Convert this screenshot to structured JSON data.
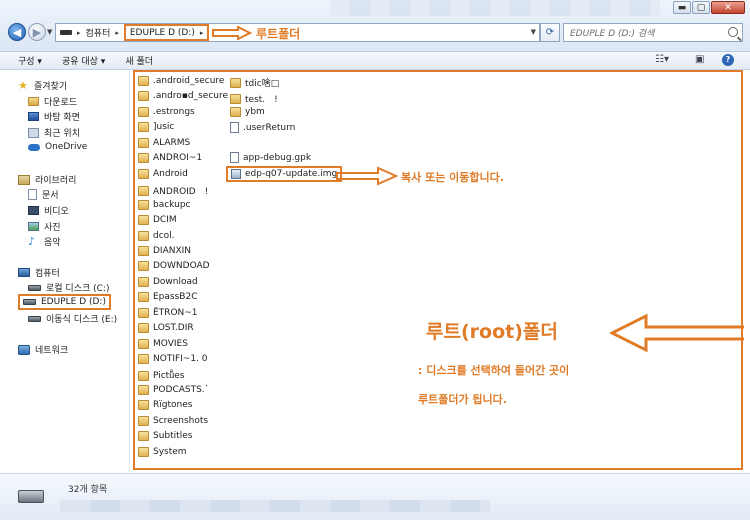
{
  "window": {
    "min_label": "▬",
    "max_label": "▢",
    "close_label": "✕"
  },
  "address": {
    "crumb_computer": "컴퓨터",
    "crumb_drive": "EDUPLE D (D:)",
    "separator": "▸",
    "search_placeholder": "EDUPLE D (D:) 검색"
  },
  "toolbar": {
    "organize": "구성 ▾",
    "share": "공유 대상 ▾",
    "new_folder": "새 폴더"
  },
  "nav": {
    "favorites": "즐겨찾기",
    "downloads": "다운로드",
    "desktop": "바탕 화면",
    "recent": "최근 위치",
    "onedrive": "OneDrive",
    "libraries": "라이브러리",
    "documents": "문서",
    "videos": "비디오",
    "pictures": "사진",
    "music": "음악",
    "computer": "컴퓨터",
    "local_disk": "로컬 디스크 (C:)",
    "eduple": "EDUPLE D (D:)",
    "removable": "이동식 디스크 (E:)",
    "network": "네트워크"
  },
  "files_col1": [
    ".android_secure",
    ".andro▪d_secure",
    ".estrongs",
    "]usic",
    "ALARMS",
    "ANDROI~1",
    "Android",
    "ANDROID　!",
    "backupc",
    "DCIM",
    "dcol.",
    "DIANXIN",
    "DOWNDOAD",
    "Download",
    "EpassB2C",
    "ËTRON~1",
    "LOST.DIR",
    "MOVIES",
    "NOTIFI~1. 0",
    "Pictuͤes",
    "PODCASTS.`",
    "Rïgtones",
    "Screenshots",
    "Subtitles",
    "System"
  ],
  "files_col2": [
    {
      "name": "tdic啥□",
      "kind": "folder"
    },
    {
      "name": "test.　!",
      "kind": "folder"
    },
    {
      "name": "ybm",
      "kind": "folder"
    },
    {
      "name": ".userReturn",
      "kind": "file"
    },
    {
      "name": "app-debug.gpk",
      "kind": "file"
    },
    {
      "name": "edp-q07-update.img",
      "kind": "image"
    }
  ],
  "annotations": {
    "root_folder_top": "루트폴더",
    "copy_or_move": "복사 또는 이동합니다.",
    "root_folder_big": "루트(root)폴더",
    "desc_line1": ": 디스크를 선택하여 들어간 곳이",
    "desc_line2": "루트폴더가 됩니다."
  },
  "details": {
    "item_count": "32개 항목"
  },
  "colors": {
    "annotation": "#e07b27",
    "window_chrome": "#dce7f5"
  },
  "icons": {
    "back": "arrow-left-icon",
    "forward": "arrow-right-icon",
    "refresh": "refresh-icon",
    "search": "search-icon",
    "folder": "folder-icon"
  }
}
